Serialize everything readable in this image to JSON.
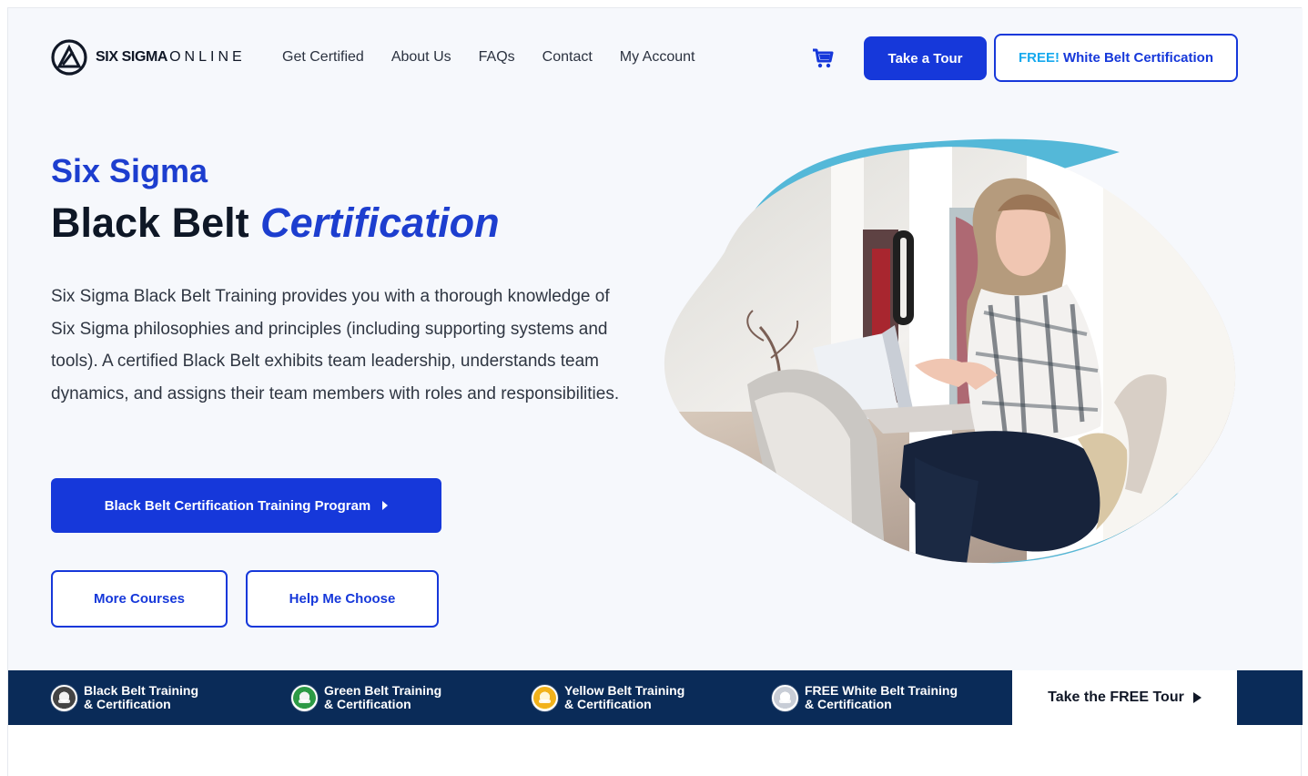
{
  "brand": {
    "logo_strong": "SIX SIGMA",
    "logo_light": "ONLINE",
    "primary_color": "#1638da",
    "accent_color": "#16a9ee",
    "navy_color": "#0a2b58"
  },
  "nav": {
    "items": [
      "Get Certified",
      "About Us",
      "FAQs",
      "Contact",
      "My Account"
    ]
  },
  "header": {
    "cart_icon": "shopping-cart-icon",
    "tour_button": "Take a Tour",
    "white_belt_prefix": "FREE!",
    "white_belt_rest": "White Belt Certification"
  },
  "hero": {
    "kicker": "Six Sigma",
    "title_main": "Black Belt",
    "title_emphasis": "Certification",
    "description": "Six Sigma Black Belt Training provides you with a thorough knowledge of Six Sigma philosophies and principles (including supporting systems and tools). A certified Black Belt exhibits team leadership, understands team dynamics, and assigns their team members with roles and responsibilities.",
    "primary_cta": "Black Belt Certification Training Program",
    "more_courses": "More Courses",
    "help_choose": "Help Me Choose"
  },
  "course_bar": {
    "items": [
      {
        "icon": "black-belt-badge-icon",
        "line1": "Black Belt Training",
        "line2": "& Certification"
      },
      {
        "icon": "green-belt-badge-icon",
        "line1": "Green Belt Training",
        "line2": "& Certification"
      },
      {
        "icon": "yellow-belt-badge-icon",
        "line1": "Yellow Belt Training",
        "line2": "& Certification"
      },
      {
        "icon": "white-belt-badge-icon",
        "line1": "FREE White Belt Training",
        "line2": "& Certification"
      }
    ],
    "free_tour": "Take the FREE Tour"
  }
}
